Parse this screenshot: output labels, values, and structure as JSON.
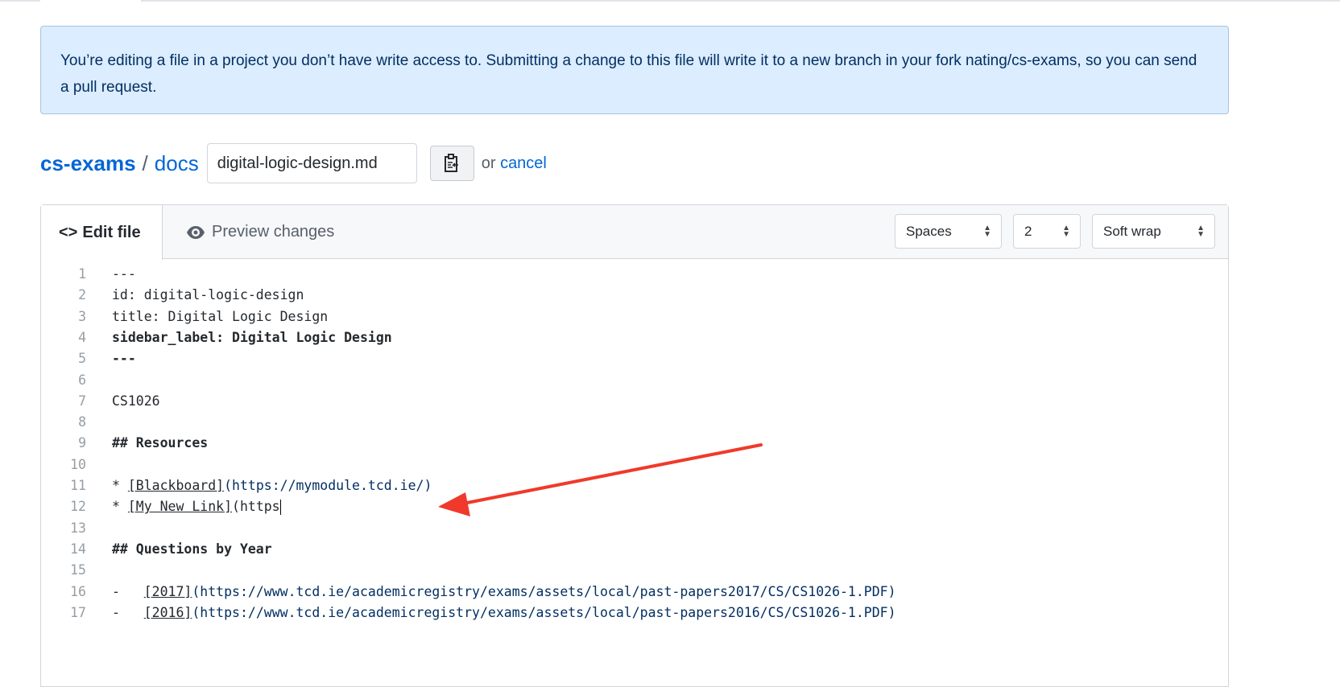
{
  "notice": "You’re editing a file in a project you don’t have write access to. Submitting a change to this file will write it to a new branch in your fork nating/cs-exams, so you can send a pull request.",
  "breadcrumb": {
    "repo": "cs-exams",
    "separator": "/",
    "folder": "docs",
    "filename": "digital-logic-design.md",
    "or": "or",
    "cancel": "cancel"
  },
  "tabs": {
    "edit": "Edit file",
    "preview": "Preview changes"
  },
  "options": {
    "indent_mode": "Spaces",
    "indent_size": "2",
    "wrap_mode": "Soft wrap"
  },
  "colors": {
    "accent": "#0366d6",
    "annotation_arrow": "#f0392b"
  },
  "code": [
    {
      "n": "1",
      "segs": [
        {
          "t": "---",
          "s": ""
        }
      ]
    },
    {
      "n": "2",
      "segs": [
        {
          "t": "id: digital-logic-design",
          "s": ""
        }
      ]
    },
    {
      "n": "3",
      "segs": [
        {
          "t": "title: Digital Logic Design",
          "s": ""
        }
      ]
    },
    {
      "n": "4",
      "segs": [
        {
          "t": "sidebar_label: Digital Logic Design",
          "s": "b"
        }
      ]
    },
    {
      "n": "5",
      "segs": [
        {
          "t": "---",
          "s": "b"
        }
      ]
    },
    {
      "n": "6",
      "segs": []
    },
    {
      "n": "7",
      "segs": [
        {
          "t": "CS1026",
          "s": ""
        }
      ]
    },
    {
      "n": "8",
      "segs": []
    },
    {
      "n": "9",
      "segs": [
        {
          "t": "## Resources",
          "s": "b"
        }
      ]
    },
    {
      "n": "10",
      "segs": []
    },
    {
      "n": "11",
      "segs": [
        {
          "t": "* ",
          "s": ""
        },
        {
          "t": "[Blackboard]",
          "s": "u"
        },
        {
          "t": "(https://mymodule.tcd.ie/)",
          "s": "url"
        }
      ]
    },
    {
      "n": "12",
      "segs": [
        {
          "t": "* ",
          "s": ""
        },
        {
          "t": "[My New Link]",
          "s": "u"
        },
        {
          "t": "(https",
          "s": ""
        }
      ],
      "cursor": true
    },
    {
      "n": "13",
      "segs": []
    },
    {
      "n": "14",
      "segs": [
        {
          "t": "## Questions by Year",
          "s": "b"
        }
      ]
    },
    {
      "n": "15",
      "segs": []
    },
    {
      "n": "16",
      "segs": [
        {
          "t": "-   ",
          "s": ""
        },
        {
          "t": "[2017]",
          "s": "u"
        },
        {
          "t": "(https://www.tcd.ie/academicregistry/exams/assets/local/past-papers2017/CS/CS1026-1.PDF)",
          "s": "url"
        }
      ]
    },
    {
      "n": "17",
      "segs": [
        {
          "t": "-   ",
          "s": ""
        },
        {
          "t": "[2016]",
          "s": "u"
        },
        {
          "t": "(https://www.tcd.ie/academicregistry/exams/assets/local/past-papers2016/CS/CS1026-1.PDF)",
          "s": "url"
        }
      ]
    }
  ]
}
